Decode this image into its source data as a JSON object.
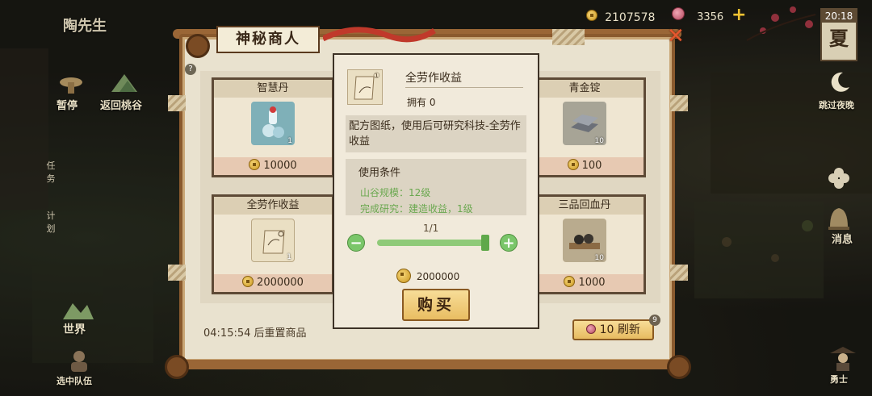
{
  "hud": {
    "player_name": "陶先生",
    "coins": "2107578",
    "shells": "3356",
    "plus": "+",
    "time": "20:18",
    "season": "夏"
  },
  "left_menu": {
    "pause": "暂停",
    "return_valley": "返回桃谷",
    "task": [
      "任",
      "务"
    ],
    "plan": [
      "计",
      "划"
    ],
    "world": "世界",
    "select_team": "选中队伍"
  },
  "right_menu": {
    "skip_night": "跳过夜晚",
    "rest": "消息",
    "warrior": "勇士"
  },
  "shop": {
    "title": "神秘商人",
    "help": "?",
    "close": "✕",
    "reset_timer": "04:15:54 后重置商品",
    "refresh_count": "10",
    "refresh_label": "刷新",
    "refresh_badge": "9",
    "items": [
      {
        "name": "智慧丹",
        "qty": "1",
        "price": "10000",
        "icon": "potion-icon"
      },
      {
        "name": "青金锭",
        "qty": "10",
        "price": "100",
        "icon": "ingot-icon"
      },
      {
        "name": "全劳作收益",
        "qty": "1",
        "price": "2000000",
        "icon": "scroll-icon"
      },
      {
        "name": "三品回血丹",
        "qty": "10",
        "price": "1000",
        "icon": "pill-tray-icon"
      }
    ]
  },
  "detail": {
    "name": "全劳作收益",
    "owned": "拥有 0",
    "icon_badge": "①",
    "description": "配方图纸，使用后可研究科技-全劳作收益",
    "conditions_title": "使用条件",
    "conditions": [
      "山谷规模：12级",
      "完成研究：建造收益，1级"
    ],
    "quantity": "1/1",
    "total_price": "2000000",
    "buy_label": "购买"
  },
  "colors": {
    "board_frame": "#8a5a2e",
    "condition_text": "#6aa84f",
    "slider_green": "#8fca78",
    "buy_button": "#f0cf7e",
    "close_red": "#e4572e"
  }
}
